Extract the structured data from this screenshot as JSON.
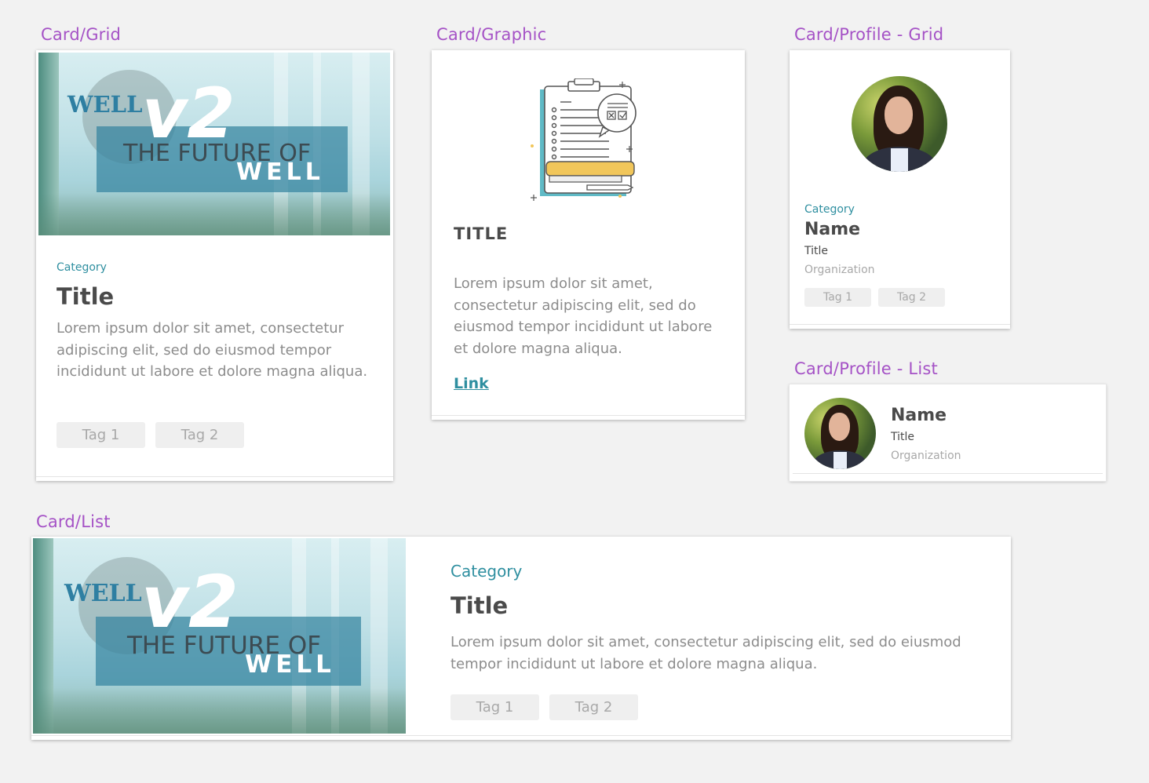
{
  "labels": {
    "card_grid": "Card/Grid",
    "card_graphic": "Card/Graphic",
    "card_profile_grid": "Card/Profile - Grid",
    "card_profile_list": "Card/Profile - List",
    "card_list": "Card/List"
  },
  "hero_image": {
    "well": "WELL",
    "v2": "v2",
    "future": "THE FUTURE OF",
    "well_bottom": "WELL"
  },
  "card_grid": {
    "category": "Category",
    "title": "Title",
    "body": "Lorem ipsum dolor sit amet, consectetur adipiscing elit, sed do eiusmod tempor incididunt ut labore et dolore magna aliqua.",
    "tags": [
      "Tag 1",
      "Tag 2"
    ]
  },
  "card_graphic": {
    "title": "TITLE",
    "body": "Lorem ipsum dolor sit amet, consectetur adipiscing elit, sed do eiusmod tempor incididunt ut labore et dolore magna aliqua.",
    "link": "Link",
    "illustration": "clipboard-checklist-icon"
  },
  "card_profile_grid": {
    "category": "Category",
    "name": "Name",
    "title": "Title",
    "organization": "Organization",
    "tags": [
      "Tag 1",
      "Tag 2"
    ]
  },
  "card_profile_list": {
    "name": "Name",
    "title": "Title",
    "organization": "Organization"
  },
  "card_list": {
    "category": "Category",
    "title": "Title",
    "body": "Lorem ipsum dolor sit amet, consectetur adipiscing elit, sed do eiusmod tempor incididunt ut labore et dolore magna aliqua.",
    "tags": [
      "Tag 1",
      "Tag 2"
    ]
  },
  "colors": {
    "label_purple": "#a552c6",
    "category_teal": "#2f8fa0",
    "title_gray": "#4a4a4a",
    "body_gray": "#8c8c8c",
    "tag_bg": "#efefef"
  }
}
